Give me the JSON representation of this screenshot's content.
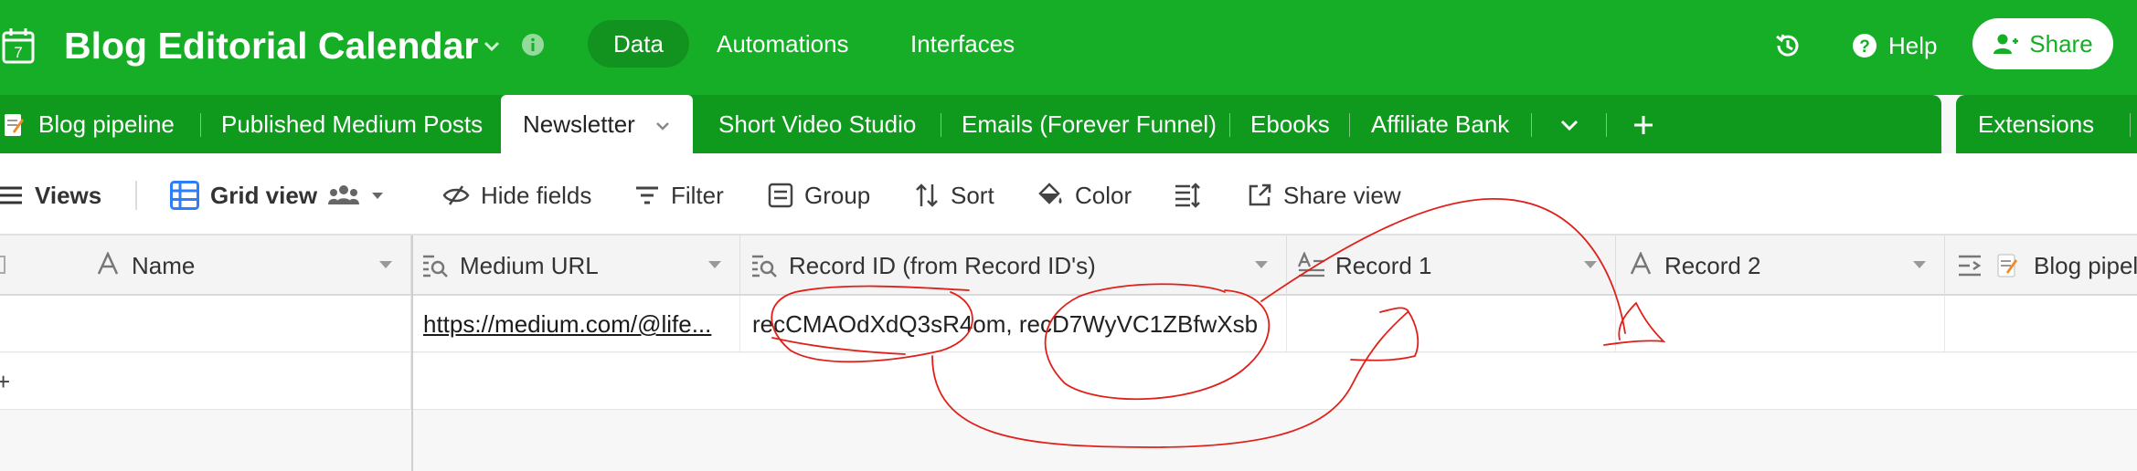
{
  "app": {
    "title": "Blog Editorial Calendar",
    "calendar_day": "7",
    "brand_color": "#16ae26"
  },
  "top_nav": {
    "items": [
      {
        "label": "Data",
        "active": true
      },
      {
        "label": "Automations",
        "active": false
      },
      {
        "label": "Interfaces",
        "active": false
      }
    ],
    "help_label": "Help",
    "share_label": "Share"
  },
  "tabs": {
    "items": [
      {
        "label": "Blog pipeline",
        "active": false
      },
      {
        "label": "Published Medium Posts",
        "active": false
      },
      {
        "label": "Newsletter",
        "active": true
      },
      {
        "label": "Short Video Studio",
        "active": false
      },
      {
        "label": "Emails (Forever Funnel)",
        "active": false
      },
      {
        "label": "Ebooks",
        "active": false
      },
      {
        "label": "Affiliate Bank",
        "active": false
      }
    ],
    "extensions_label": "Extensions"
  },
  "toolbar": {
    "views_label": "Views",
    "view_name": "Grid view",
    "hide_fields_label": "Hide fields",
    "filter_label": "Filter",
    "group_label": "Group",
    "sort_label": "Sort",
    "color_label": "Color",
    "share_view_label": "Share view"
  },
  "grid": {
    "columns": [
      {
        "label": "Name",
        "icon": "text-icon"
      },
      {
        "label": "Medium URL",
        "icon": "lookup-icon"
      },
      {
        "label": "Record ID (from Record ID's)",
        "icon": "lookup-icon"
      },
      {
        "label": "Record 1",
        "icon": "long-text-icon"
      },
      {
        "label": "Record 2",
        "icon": "text-icon"
      },
      {
        "label": "Blog pipel",
        "icon": "link-icon"
      }
    ],
    "rows": [
      {
        "name": "",
        "medium_url": "https://medium.com/@life...",
        "record_ids": "recCMAOdXdQ3sR4om, recD7WyVC1ZBfwXsb",
        "record_1": "",
        "record_2": ""
      }
    ]
  },
  "annotation_color": "#e0201a"
}
